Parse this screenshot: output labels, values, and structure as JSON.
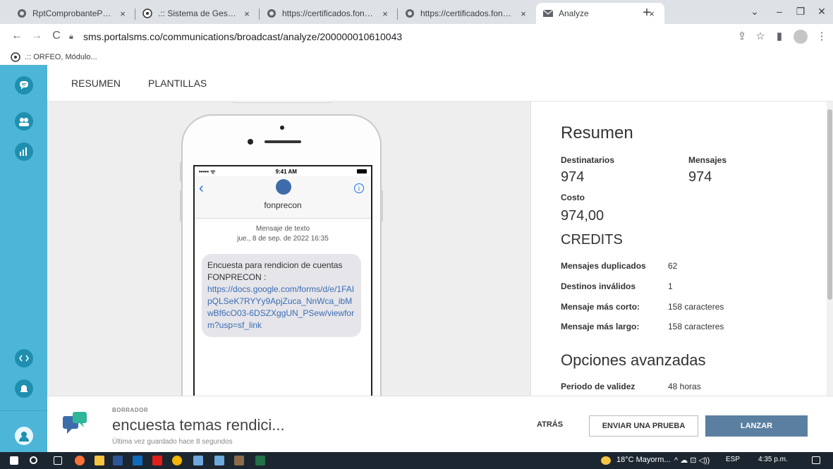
{
  "browser": {
    "tabs": [
      {
        "title": "RptComprobantePago",
        "close": "×"
      },
      {
        "title": ".:: Sistema de Gestión Docu",
        "close": "×"
      },
      {
        "title": "https://certificados.fonprec",
        "close": "×"
      },
      {
        "title": "https://certificados.fonprec",
        "close": "×"
      },
      {
        "title": "Analyze",
        "close": "×"
      }
    ],
    "new_tab": "+",
    "window_controls": [
      "⌄",
      "–",
      "❐",
      "✕"
    ],
    "url": "sms.portalsms.co/communications/broadcast/analyze/200000010610043",
    "bookmark": ".:: ORFEO, Módulo...",
    "nav": {
      "back": "←",
      "forward": "→",
      "reload": "C"
    },
    "toolbar_icons": [
      "⇪",
      "☆",
      "▮",
      "⋮"
    ]
  },
  "app": {
    "tabs": [
      "RESUMEN",
      "PLANTILLAS"
    ]
  },
  "phone": {
    "time": "9:41 AM",
    "signal": "••••• ᯤ",
    "back": "‹",
    "info": "i",
    "sender": "fonprecon",
    "meta_line1": "Mensaje de texto",
    "meta_line2": "jue., 8 de sep. de 2022 16:35",
    "message_text": "Encuesta para rendicion de cuentas FONPRECON :",
    "message_link": "https://docs.google.com/forms/d/e/1FAIpQLSeK7RYYy9ApjZuca_NnWca_ibMwBf6cO03-6DSZXggUN_PSew/viewform?usp=sf_link"
  },
  "summary": {
    "title": "Resumen",
    "recipients_label": "Destinatarios",
    "recipients_value": "974",
    "messages_label": "Mensajes",
    "messages_value": "974",
    "cost_label": "Costo",
    "cost_value": "974,00",
    "cost_unit": "CREDITS",
    "stats": [
      {
        "label": "Mensajes duplicados",
        "value": "62"
      },
      {
        "label": "Destinos inválidos",
        "value": "1"
      },
      {
        "label": "Mensaje más corto:",
        "value": "158 caracteres"
      },
      {
        "label": "Mensaje más largo:",
        "value": "158 caracteres"
      }
    ],
    "advanced_title": "Opciones avanzadas",
    "validity_label": "Periodo de validez",
    "validity_value": "48 horas"
  },
  "actionbar": {
    "draft_label": "BORRADOR",
    "draft_title": "encuesta temas rendici...",
    "saved_text": "Última vez guardado hace 8 segundos",
    "back_label": "ATRÁS",
    "test_label": "ENVIAR UNA PRUEBA",
    "launch_label": "LANZAR"
  },
  "taskbar": {
    "weather": "18°C  Mayorm...",
    "tray": "^  ☁  ⊡  ◁))",
    "lang": "ESP",
    "clock": "4:35 p.m."
  },
  "colors": {
    "sidebar": "#4db6d8",
    "sidebar_icon": "#1f8fb0",
    "launch_button": "#5b7fa0",
    "link": "#3b6db3"
  }
}
